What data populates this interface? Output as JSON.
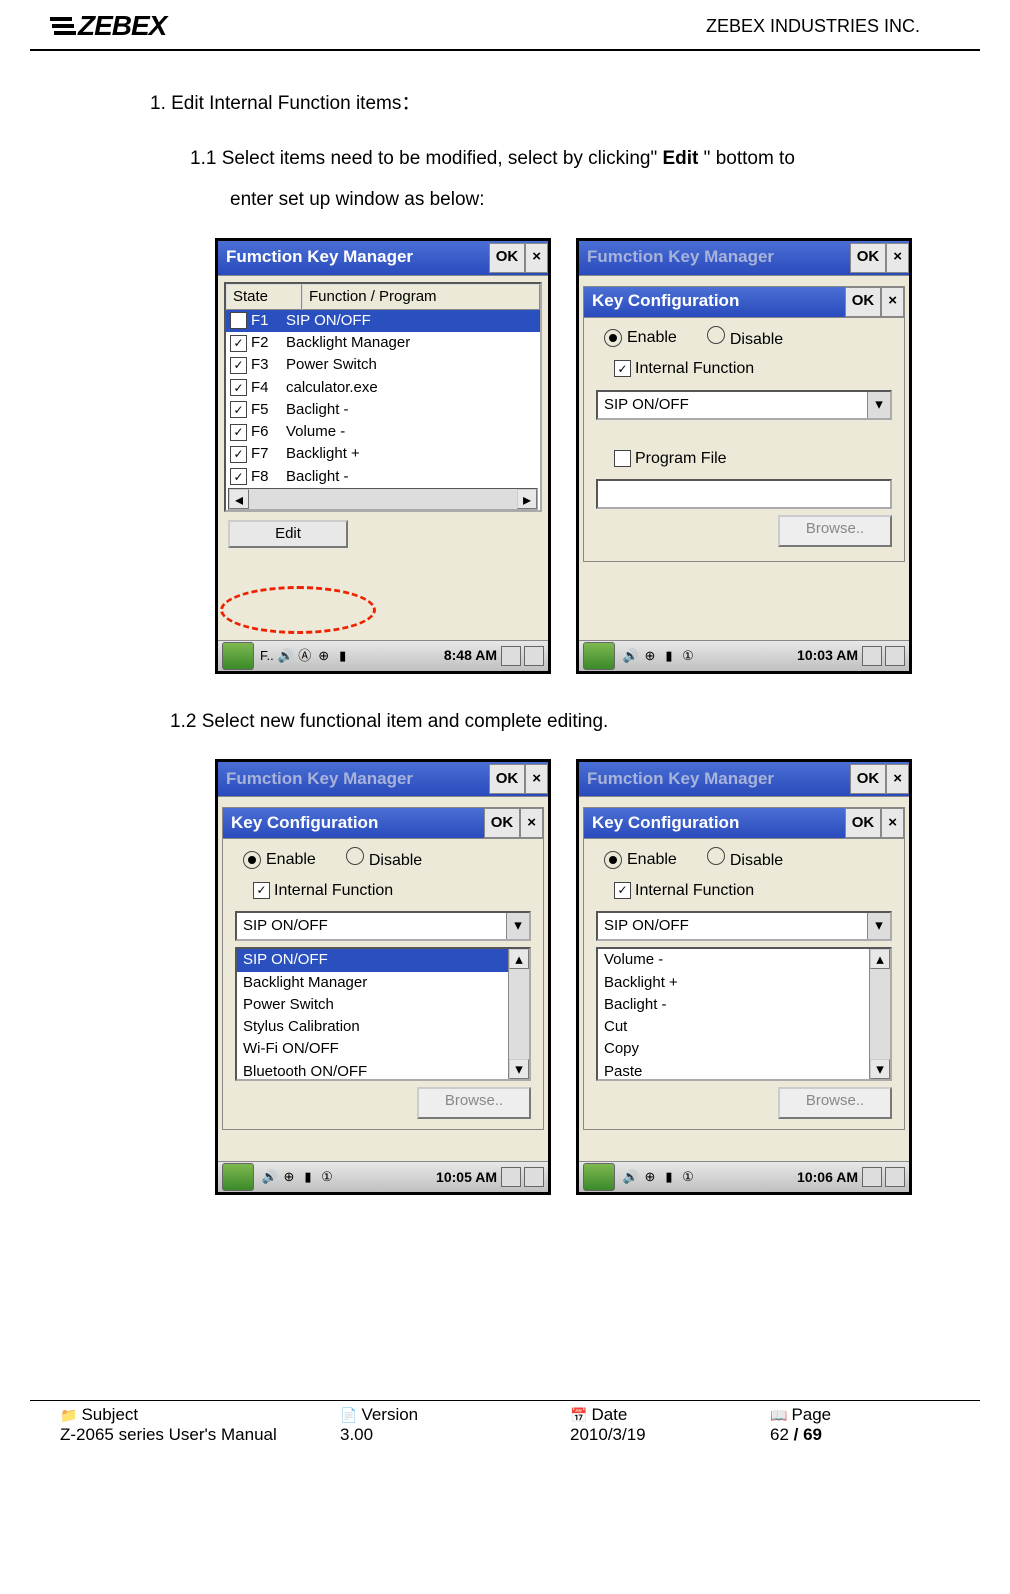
{
  "header": {
    "logo_text": "ZEBEX",
    "company": "ZEBEX INDUSTRIES INC."
  },
  "content": {
    "section1_title": "1. Edit Internal Function items：",
    "step1_1_a": "1.1 Select items need to be modified, select by clicking\" ",
    "step1_1_bold": "Edit",
    "step1_1_b": " \" bottom to",
    "step1_1_c": "enter set up window as below:",
    "step1_2": "1.2 Select new functional item and complete editing."
  },
  "s1": {
    "title": "Fumction Key Manager",
    "ok": "OK",
    "th_state": "State",
    "th_func": "Function / Program",
    "rows": [
      {
        "k": "F1",
        "f": "SIP ON/OFF",
        "sel": true
      },
      {
        "k": "F2",
        "f": "Backlight Manager"
      },
      {
        "k": "F3",
        "f": "Power Switch"
      },
      {
        "k": "F4",
        "f": "calculator.exe"
      },
      {
        "k": "F5",
        "f": "Baclight -"
      },
      {
        "k": "F6",
        "f": "Volume -"
      },
      {
        "k": "F7",
        "f": "Backlight +"
      },
      {
        "k": "F8",
        "f": "Baclight -"
      }
    ],
    "edit": "Edit",
    "task": "F..",
    "time": "8:48 AM"
  },
  "s2": {
    "title_bg": "Fumction Key Manager",
    "subtitle": "Key Configuration",
    "ok": "OK",
    "enable": "Enable",
    "disable": "Disable",
    "internal": "Internal Function",
    "dd_value": "SIP ON/OFF",
    "program": "Program File",
    "browse": "Browse..",
    "time": "10:03 AM"
  },
  "s3": {
    "title_bg": "Fumction Key Manager",
    "subtitle": "Key Configuration",
    "ok": "OK",
    "enable": "Enable",
    "disable": "Disable",
    "internal": "Internal Function",
    "dd_value": "SIP ON/OFF",
    "list": [
      "SIP ON/OFF",
      "Backlight Manager",
      "Power Switch",
      "Stylus Calibration",
      "Wi-Fi ON/OFF",
      "Bluetooth ON/OFF"
    ],
    "browse": "Browse..",
    "time": "10:05 AM"
  },
  "s4": {
    "title_bg": "Fumction Key Manager",
    "subtitle": "Key Configuration",
    "ok": "OK",
    "enable": "Enable",
    "disable": "Disable",
    "internal": "Internal Function",
    "dd_value": "SIP ON/OFF",
    "list": [
      "Volume -",
      "Backlight +",
      "Baclight -",
      "Cut",
      "Copy",
      "Paste"
    ],
    "browse": "Browse..",
    "time": "10:06 AM"
  },
  "footer": {
    "subject_label": "Subject",
    "subject_value": "Z-2065 series User's Manual",
    "version_label": "Version",
    "version_value": "3.00",
    "date_label": "Date",
    "date_value": "2010/3/19",
    "page_label": "Page",
    "page_cur": "62",
    "page_sep": " / ",
    "page_total": "69"
  }
}
